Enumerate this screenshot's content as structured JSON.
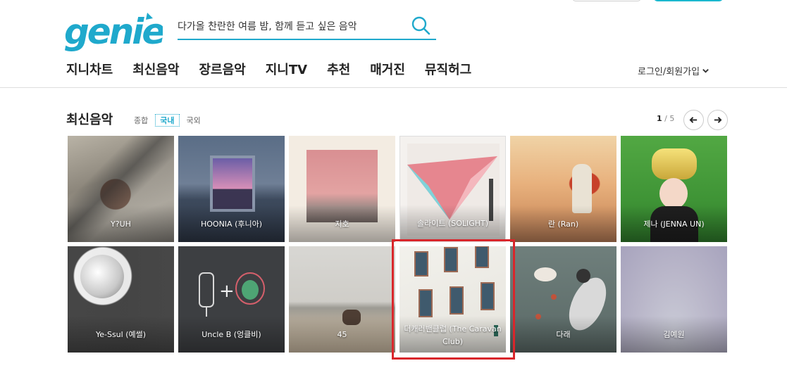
{
  "brand": {
    "logo_text": "genie",
    "accent_color": "#1fa9cc"
  },
  "search": {
    "placeholder": "다가올 찬란한 여름 밤, 함께 듣고 싶은 음악",
    "icon": "search-icon"
  },
  "nav": {
    "items": [
      "지니차트",
      "최신음악",
      "장르음악",
      "지니TV",
      "추천",
      "매거진",
      "뮤직허그"
    ],
    "login_label": "로그인/회원가입"
  },
  "section": {
    "title": "최신음악",
    "tabs": [
      {
        "label": "종합",
        "active": false
      },
      {
        "label": "국내",
        "active": true
      },
      {
        "label": "국외",
        "active": false
      }
    ],
    "pager": {
      "current": "1",
      "total": "/ 5"
    }
  },
  "albums": [
    {
      "artist": "Y?UH"
    },
    {
      "artist": "HOONIA (후니아)"
    },
    {
      "artist": "지호"
    },
    {
      "artist": "솔라이트 (SOLIGHT)"
    },
    {
      "artist": "란 (Ran)"
    },
    {
      "artist": "제나 (JENNA UN)"
    },
    {
      "artist": "Ye-Ssul (예썰)"
    },
    {
      "artist": "Uncle B (엉클비)"
    },
    {
      "artist": "45"
    },
    {
      "artist": "더캐러밴클럽 (The Caravan Club)",
      "highlighted": true
    },
    {
      "artist": "다래"
    },
    {
      "artist": "김예원"
    }
  ],
  "highlight_color": "#d9262b"
}
